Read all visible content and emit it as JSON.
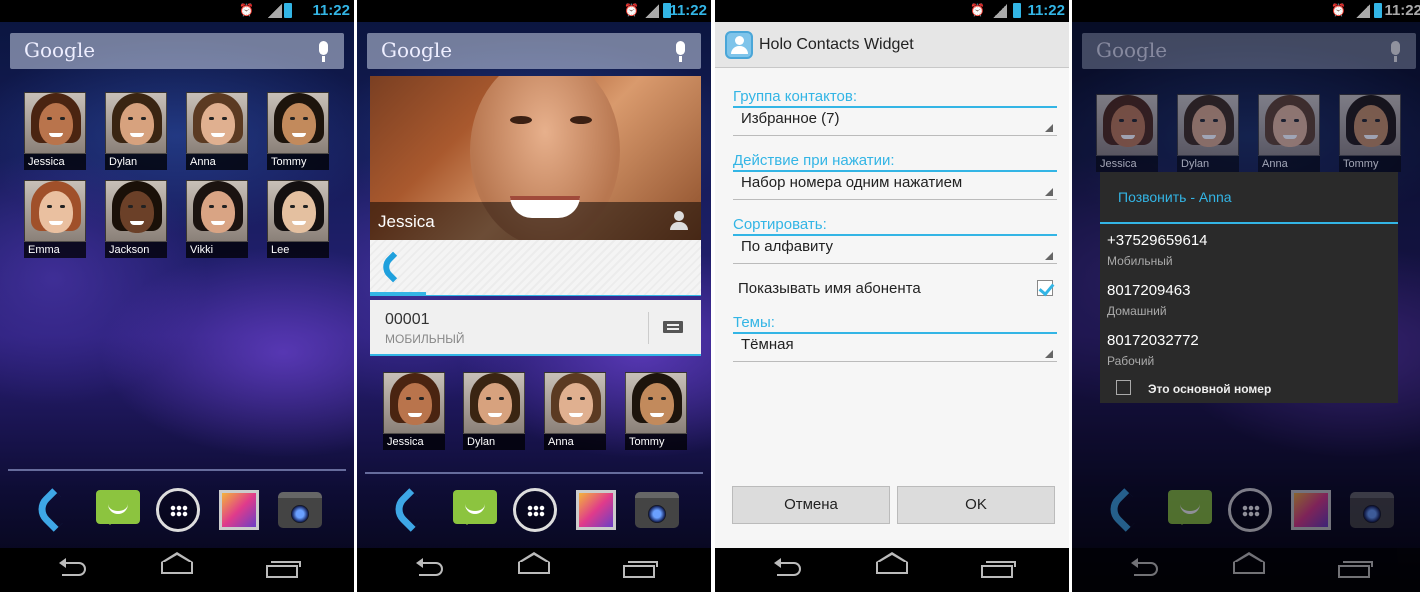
{
  "status": {
    "time": "11:22"
  },
  "google": {
    "label": "Google"
  },
  "contacts": [
    {
      "name": "Jessica",
      "skin": "#b9744c",
      "hair": "#4a2411"
    },
    {
      "name": "Dylan",
      "skin": "#d7a27e",
      "hair": "#3a2512"
    },
    {
      "name": "Anna",
      "skin": "#e0b090",
      "hair": "#5b3a22"
    },
    {
      "name": "Tommy",
      "skin": "#c28a5c",
      "hair": "#1d140c"
    },
    {
      "name": "Emma",
      "skin": "#eac0a0",
      "hair": "#a0502a"
    },
    {
      "name": "Jackson",
      "skin": "#6b4028",
      "hair": "#1a1008"
    },
    {
      "name": "Vikki",
      "skin": "#d9a484",
      "hair": "#1b1310"
    },
    {
      "name": "Lee",
      "skin": "#e4c0a0",
      "hair": "#141010"
    }
  ],
  "card": {
    "name": "Jessica",
    "number": "00001",
    "number_type": "МОБИЛЬНЫЙ"
  },
  "settings": {
    "title": "Holo Contacts Widget",
    "group_label": "Группа контактов:",
    "group_value": "Избранное (7)",
    "action_label": "Действие при нажатии:",
    "action_value": "Набор номера одним нажатием",
    "sort_label": "Сортировать:",
    "sort_value": "По алфавиту",
    "show_name_label": "Показывать имя абонента",
    "show_name_checked": true,
    "theme_label": "Темы:",
    "theme_value": "Тёмная",
    "cancel_label": "Отмена",
    "ok_label": "OK"
  },
  "call_dialog": {
    "title": "Позвонить - Anna",
    "numbers": [
      {
        "number": "+37529659614",
        "type": "Мобильный"
      },
      {
        "number": "8017209463",
        "type": "Домашний"
      },
      {
        "number": "80172032772",
        "type": "Рабочий"
      }
    ],
    "default_label": "Это основной номер"
  },
  "colors": {
    "accent": "#33b5e5"
  },
  "dock_icons": [
    "phone-icon",
    "messaging-icon",
    "app-drawer-icon",
    "gallery-icon",
    "camera-icon"
  ],
  "nav_icons": [
    "back-icon",
    "home-icon",
    "recent-apps-icon"
  ]
}
